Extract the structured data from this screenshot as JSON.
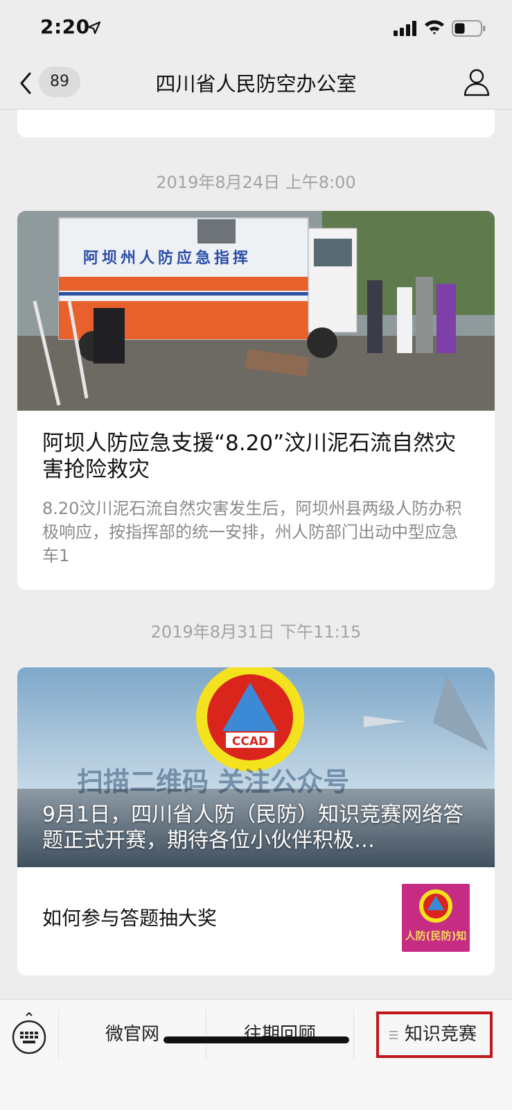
{
  "status_bar": {
    "time": "2:20"
  },
  "nav": {
    "unread_count": "89",
    "title": "四川省人民防空办公室"
  },
  "feed": {
    "items": [
      {
        "date": "2019年8月24日 上午8:00",
        "title": "阿坝人防应急支援“8.20”汶川泥石流自然灾害抢险救灾",
        "digest": "8.20汶川泥石流自然灾害发生后，阿坝州县两级人防办积极响应，按指挥部的统一安排，州人防部门出动中型应急车1",
        "image_text": "阿坝州人防应急指挥"
      },
      {
        "date": "2019年8月31日 下午11:15",
        "title": "9月1日，四川省人防（民防）知识竞赛网络答题正式开赛，期待各位小伙伴积极…",
        "sub_title": "如何参与答题抽大奖",
        "image_text": {
          "logo": "CCAD",
          "banner_line_1": "扫描二维码 关注公众号",
          "thumb_text": "人防(民防)知"
        }
      }
    ]
  },
  "menu": {
    "items": [
      {
        "label": "微官网"
      },
      {
        "label": "往期回顾"
      },
      {
        "label": "知识竞赛"
      }
    ],
    "highlight_color": "#c0161c"
  }
}
